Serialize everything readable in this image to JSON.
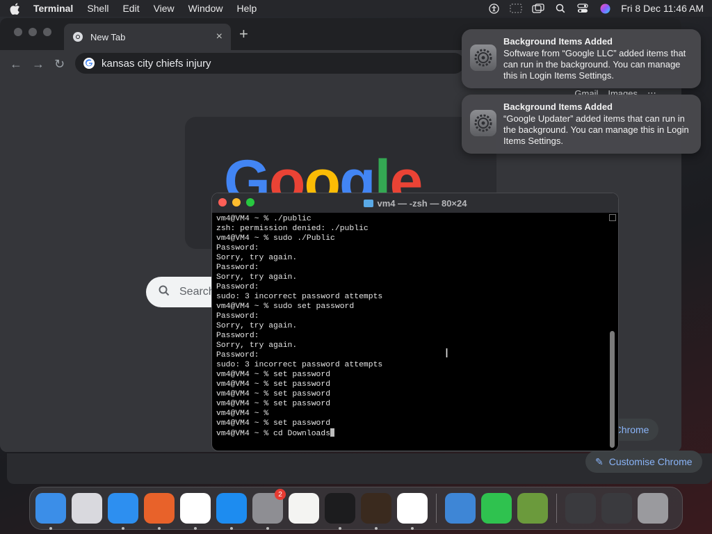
{
  "menubar": {
    "app_name": "Terminal",
    "menus": [
      "Shell",
      "Edit",
      "View",
      "Window",
      "Help"
    ],
    "clock": "Fri 8 Dec  11:46 AM"
  },
  "chrome": {
    "tab_title": "New Tab",
    "tab_close": "×",
    "new_tab": "+",
    "address": "kansas city chiefs injury",
    "top_links": [
      "Gmail",
      "Images"
    ],
    "logo_text": "Google",
    "search_placeholder": "Search",
    "customise_label": "Customise Chrome",
    "customise_partial": "e Chrome"
  },
  "notifications": [
    {
      "title": "Background Items Added",
      "body": "Software from “Google LLC” added items that can run in the background. You can manage this in Login Items Settings."
    },
    {
      "title": "Background Items Added",
      "body": "“Google Updater” added items that can run in the background. You can manage this in Login Items Settings."
    }
  ],
  "terminal": {
    "title": "vm4 — -zsh — 80×24",
    "lines": [
      "vm4@VM4 ~ % ./public",
      "zsh: permission denied: ./public",
      "vm4@VM4 ~ % sudo ./Public",
      "Password:",
      "Sorry, try again.",
      "Password:",
      "Sorry, try again.",
      "Password:",
      "sudo: 3 incorrect password attempts",
      "vm4@VM4 ~ % sudo set password",
      "Password:",
      "Sorry, try again.",
      "Password:",
      "Sorry, try again.",
      "Password:",
      "sudo: 3 incorrect password attempts",
      "vm4@VM4 ~ % set password",
      "vm4@VM4 ~ % set password",
      "vm4@VM4 ~ % set password",
      "vm4@VM4 ~ % set password",
      "vm4@VM4 ~ %",
      "vm4@VM4 ~ % set password",
      "vm4@VM4 ~ % cd Downloads"
    ]
  },
  "dock": {
    "apps": [
      {
        "name": "finder-icon",
        "color": "#3b8ee8"
      },
      {
        "name": "launchpad-icon",
        "color": "#d9d9de"
      },
      {
        "name": "safari-icon",
        "color": "#2d8ff0"
      },
      {
        "name": "firefox-icon",
        "color": "#e8622a"
      },
      {
        "name": "chrome-icon",
        "color": "#ffffff"
      },
      {
        "name": "app-store-icon",
        "color": "#1d8cf0"
      },
      {
        "name": "system-settings-icon",
        "color": "#8e8e93",
        "badge": "2"
      },
      {
        "name": "textedit-icon",
        "color": "#f4f4f2"
      },
      {
        "name": "terminal-icon",
        "color": "#1c1c1e"
      },
      {
        "name": "garageband-icon",
        "color": "#3a2a1e"
      },
      {
        "name": "vscode-icon",
        "color": "#ffffff"
      },
      {
        "name": "weather-icon",
        "color": "#3e86d6"
      },
      {
        "name": "facetime-icon",
        "color": "#2fc24f"
      },
      {
        "name": "minecraft-icon",
        "color": "#6b9a3c"
      },
      {
        "name": "window-preview-icon",
        "color": "#3a3a3e"
      },
      {
        "name": "window-preview-icon",
        "color": "#3a3a3e"
      },
      {
        "name": "trash-icon",
        "color": "#9a9a9e"
      }
    ]
  }
}
